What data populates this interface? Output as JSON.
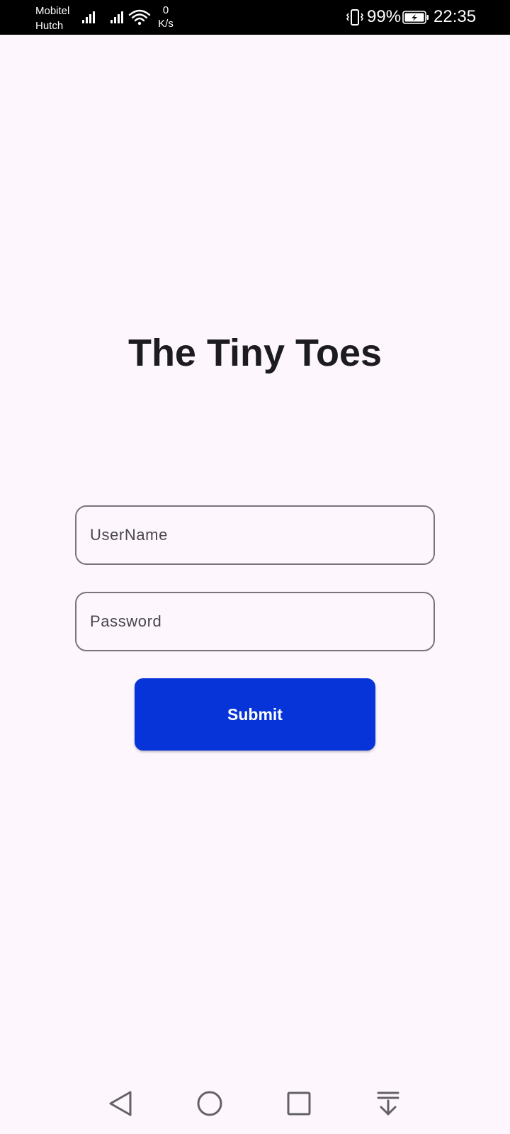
{
  "status_bar": {
    "carrier_1": "Mobitel",
    "carrier_2": "Hutch",
    "net_speed_value": "0",
    "net_speed_unit": "K/s",
    "battery_percent": "99%",
    "time": "22:35",
    "icons": [
      "signal-icon",
      "signal-icon",
      "wifi-icon",
      "vibrate-icon",
      "battery-charging-icon"
    ]
  },
  "app": {
    "title": "The Tiny Toes"
  },
  "form": {
    "username_placeholder": "UserName",
    "username_value": "",
    "password_placeholder": "Password",
    "password_value": "",
    "submit_label": "Submit"
  },
  "nav_bar": {
    "icons": [
      "back-icon",
      "home-icon",
      "recents-icon",
      "notification-drawer-icon"
    ]
  },
  "colors": {
    "background": "#fdf7fd",
    "title_text": "#1c1b20",
    "field_border": "#79747e",
    "placeholder_text": "#49454f",
    "primary_button": "#0634d8",
    "status_bar": "#000000"
  }
}
